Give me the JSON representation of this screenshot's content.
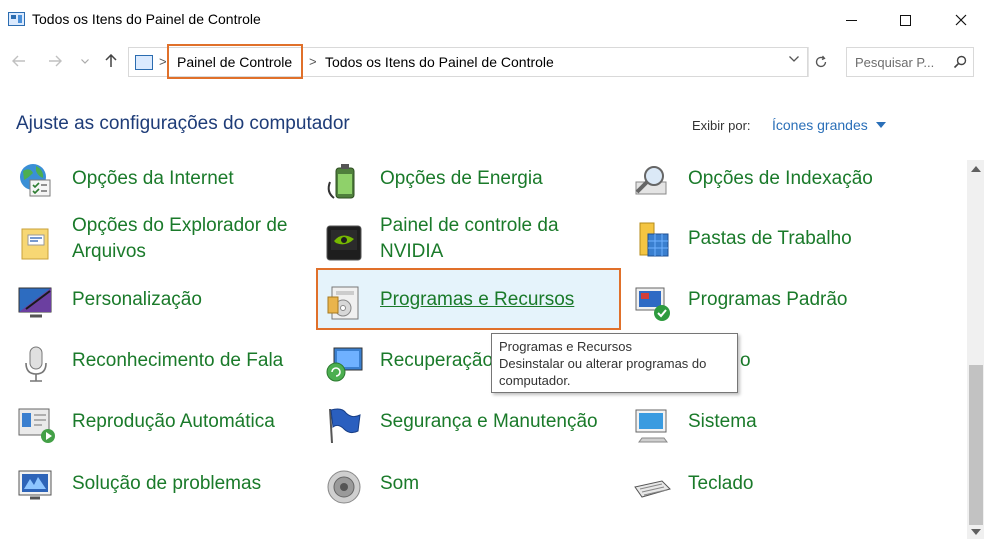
{
  "window": {
    "title": "Todos os Itens do Painel de Controle"
  },
  "address": {
    "crumbs": [
      "Painel de Controle",
      "Todos os Itens do Painel de Controle"
    ],
    "separator": ">"
  },
  "search": {
    "placeholder": "Pesquisar P..."
  },
  "header": {
    "title": "Ajuste as configurações do computador",
    "view_label": "Exibir por:",
    "view_value": "Ícones grandes"
  },
  "items": {
    "internet_options": "Opções da Internet",
    "energy_options": "Opções de Energia",
    "indexing_options": "Opções de Indexação",
    "explorer_options": "Opções do Explorador de Arquivos",
    "nvidia": "Painel de controle da NVIDIA",
    "work_folders": "Pastas de Trabalho",
    "personalization": "Personalização",
    "programs": "Programas e Recursos",
    "default_programs": "Programas Padrão",
    "speech": "Reconhecimento de Fala",
    "recovery": "Recuperação",
    "region": "o",
    "autoplay": "Reprodução Automática",
    "security": "Segurança e Manutenção",
    "system": "Sistema",
    "troubleshooting": "Solução de problemas",
    "sound": "Som",
    "keyboard": "Teclado"
  },
  "tooltip": {
    "title": "Programas e Recursos",
    "line1": "Desinstalar ou alterar programas do",
    "line2": "computador."
  },
  "colors": {
    "link_green": "#1a7a2a",
    "title_blue": "#1e3c78",
    "highlight_orange": "#e0702a",
    "hover_blue": "#e5f3fb"
  }
}
